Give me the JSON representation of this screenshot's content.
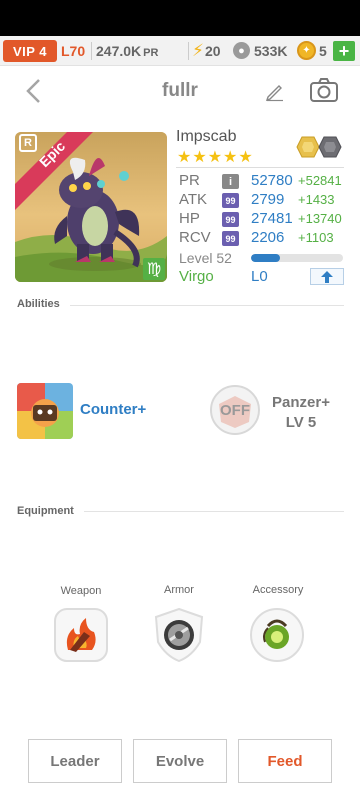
{
  "resources": {
    "vip": "VIP 4",
    "level": "L70",
    "power": "247.0K",
    "power_unit": "PR",
    "energy": "20",
    "food": "533K",
    "gems": "5",
    "plus": "+"
  },
  "nav": {
    "title": "fullr"
  },
  "monster": {
    "name": "Impscab",
    "rarity": "Epic",
    "stars": "★★★★★",
    "level_label": "Level 52",
    "level_progress_percent": 32,
    "sign": "Virgo",
    "luck": "L0"
  },
  "stats": [
    {
      "label": "PR",
      "badge": "i",
      "value": "52780",
      "bonus": "+52841"
    },
    {
      "label": "ATK",
      "badge": "99",
      "value": "2799",
      "bonus": "+1433"
    },
    {
      "label": "HP",
      "badge": "99",
      "value": "27481",
      "bonus": "+13740"
    },
    {
      "label": "RCV",
      "badge": "99",
      "value": "2206",
      "bonus": "+1103"
    }
  ],
  "abilities": {
    "title": "Abilities",
    "items": [
      {
        "name": "Counter+"
      },
      {
        "name_line1": "Panzer+",
        "name_line2": "LV 5",
        "status": "OFF"
      }
    ]
  },
  "equipment": {
    "title": "Equipment",
    "slots": [
      {
        "label": "Weapon",
        "icon": "flame-weapon-icon"
      },
      {
        "label": "Armor",
        "icon": "armor-shield-icon"
      },
      {
        "label": "Accessory",
        "icon": "green-orb-accessory-icon"
      }
    ]
  },
  "buttons": {
    "leader": "Leader",
    "evolve": "Evolve",
    "feed": "Feed"
  },
  "colors": {
    "accent": "#e2582a",
    "blue": "#2f7ec4",
    "green": "#55b045",
    "star": "#f5c112"
  }
}
